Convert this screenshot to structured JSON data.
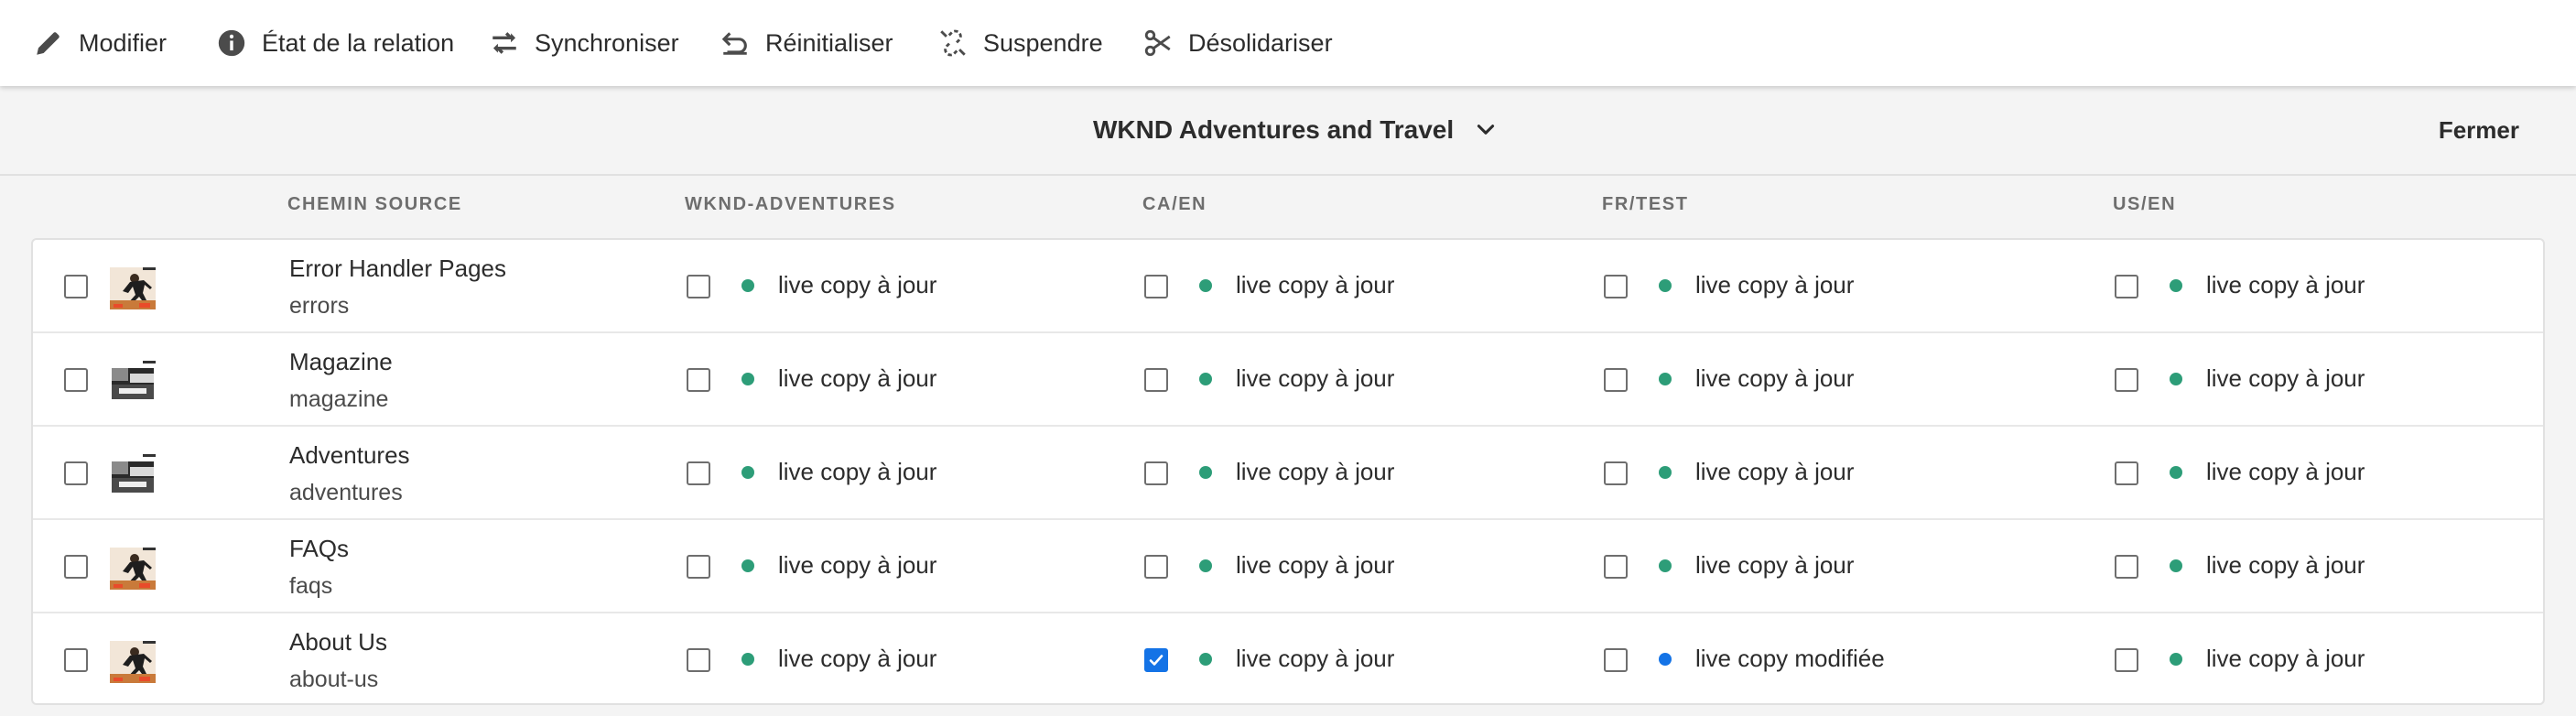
{
  "toolbar": {
    "modifier": "Modifier",
    "etat": "État de la relation",
    "synchroniser": "Synchroniser",
    "reinitialiser": "Réinitialiser",
    "suspendre": "Suspendre",
    "desolidariser": "Désolidariser"
  },
  "header": {
    "relation_title": "WKND Adventures and Travel",
    "close_label": "Fermer"
  },
  "columns": {
    "source": "CHEMIN SOURCE",
    "c1": "WKND-ADVENTURES",
    "c2": "CA/EN",
    "c3": "FR/TEST",
    "c4": "US/EN"
  },
  "colors": {
    "up_to_date": "#2d9d78",
    "modified": "#1473e6",
    "checkbox_checked": "#1473e6"
  },
  "rows": [
    {
      "title": "Error Handler Pages",
      "name": "errors",
      "thumbnail": "adventure-thumbnail",
      "cells": [
        {
          "status": "live copy à jour",
          "state": "up_to_date",
          "checked": false
        },
        {
          "status": "live copy à jour",
          "state": "up_to_date",
          "checked": false
        },
        {
          "status": "live copy à jour",
          "state": "up_to_date",
          "checked": false
        },
        {
          "status": "live copy à jour",
          "state": "up_to_date",
          "checked": false
        }
      ]
    },
    {
      "title": "Magazine",
      "name": "magazine",
      "thumbnail": "magazine-thumbnail",
      "cells": [
        {
          "status": "live copy à jour",
          "state": "up_to_date",
          "checked": false
        },
        {
          "status": "live copy à jour",
          "state": "up_to_date",
          "checked": false
        },
        {
          "status": "live copy à jour",
          "state": "up_to_date",
          "checked": false
        },
        {
          "status": "live copy à jour",
          "state": "up_to_date",
          "checked": false
        }
      ]
    },
    {
      "title": "Adventures",
      "name": "adventures",
      "thumbnail": "magazine-thumbnail",
      "cells": [
        {
          "status": "live copy à jour",
          "state": "up_to_date",
          "checked": false
        },
        {
          "status": "live copy à jour",
          "state": "up_to_date",
          "checked": false
        },
        {
          "status": "live copy à jour",
          "state": "up_to_date",
          "checked": false
        },
        {
          "status": "live copy à jour",
          "state": "up_to_date",
          "checked": false
        }
      ]
    },
    {
      "title": "FAQs",
      "name": "faqs",
      "thumbnail": "adventure-thumbnail",
      "cells": [
        {
          "status": "live copy à jour",
          "state": "up_to_date",
          "checked": false
        },
        {
          "status": "live copy à jour",
          "state": "up_to_date",
          "checked": false
        },
        {
          "status": "live copy à jour",
          "state": "up_to_date",
          "checked": false
        },
        {
          "status": "live copy à jour",
          "state": "up_to_date",
          "checked": false
        }
      ]
    },
    {
      "title": "About Us",
      "name": "about-us",
      "thumbnail": "adventure-thumbnail",
      "cells": [
        {
          "status": "live copy à jour",
          "state": "up_to_date",
          "checked": false
        },
        {
          "status": "live copy à jour",
          "state": "up_to_date",
          "checked": true
        },
        {
          "status": "live copy modifiée",
          "state": "modified",
          "checked": false
        },
        {
          "status": "live copy à jour",
          "state": "up_to_date",
          "checked": false
        }
      ]
    }
  ]
}
